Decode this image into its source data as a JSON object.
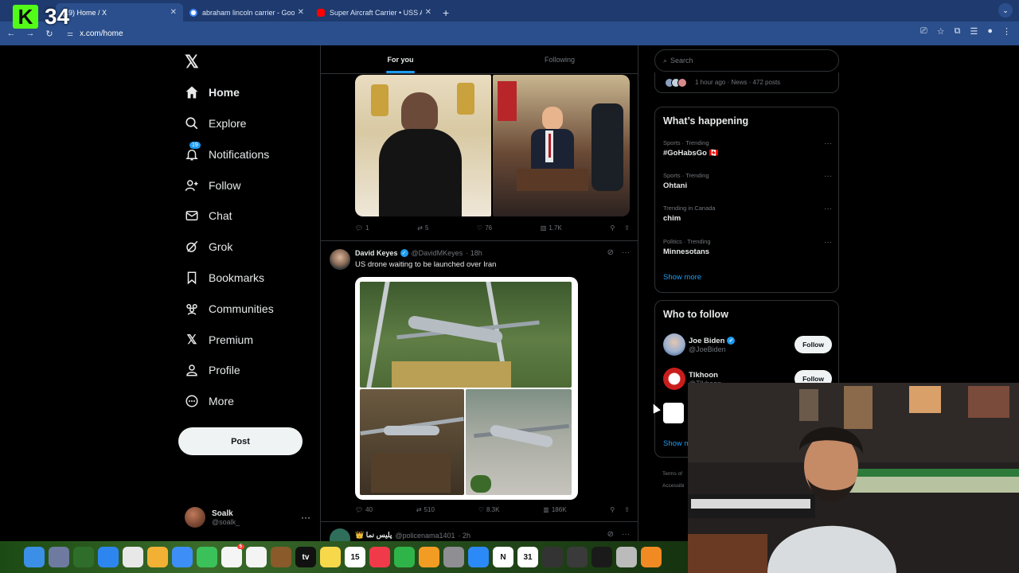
{
  "overlay": {
    "kick_letter": "K",
    "viewer_count": "34"
  },
  "browser": {
    "tabs": [
      {
        "title": "(19) Home / X",
        "active": true,
        "favicon_color": "#000000"
      },
      {
        "title": "abraham lincoln carrier - Goo",
        "active": false,
        "favicon_color": "#4285f4"
      },
      {
        "title": "Super Aircraft Carrier • USS A",
        "active": false,
        "favicon_color": "#ff0000"
      }
    ],
    "url": "x.com/home"
  },
  "nav": {
    "items": [
      {
        "label": "Home",
        "icon": "home-icon",
        "bold": true
      },
      {
        "label": "Explore",
        "icon": "search-icon"
      },
      {
        "label": "Notifications",
        "icon": "bell-icon",
        "badge": "19"
      },
      {
        "label": "Follow",
        "icon": "person-add-icon"
      },
      {
        "label": "Chat",
        "icon": "mail-icon"
      },
      {
        "label": "Grok",
        "icon": "grok-icon"
      },
      {
        "label": "Bookmarks",
        "icon": "bookmark-icon"
      },
      {
        "label": "Communities",
        "icon": "communities-icon"
      },
      {
        "label": "Premium",
        "icon": "x-premium-icon"
      },
      {
        "label": "Profile",
        "icon": "person-icon"
      },
      {
        "label": "More",
        "icon": "more-circle-icon"
      }
    ],
    "post_label": "Post",
    "account": {
      "name": "Soalk",
      "handle": "@soalk_"
    }
  },
  "timeline": {
    "tabs": [
      {
        "label": "For you",
        "active": true
      },
      {
        "label": "Following",
        "active": false
      }
    ],
    "tweet1": {
      "stats": {
        "replies": "1",
        "reposts": "5",
        "likes": "76",
        "views": "1.7K"
      }
    },
    "tweet2": {
      "name": "David Keyes",
      "handle": "@DavidMKeyes",
      "time": "· 18h",
      "text": "US drone waiting to be launched over Iran",
      "stats": {
        "replies": "40",
        "reposts": "510",
        "likes": "8.3K",
        "views": "186K"
      }
    },
    "tweet3": {
      "name": "👑 پلیس نما",
      "handle": "@policenama1401",
      "time": "· 2h"
    }
  },
  "sidebar": {
    "search_placeholder": "Search",
    "news_strip": "1 hour ago · News · 472 posts",
    "whats_happening_title": "What’s happening",
    "trends": [
      {
        "meta": "Sports · Trending",
        "name": "#GoHabsGo 🇨🇦"
      },
      {
        "meta": "Sports · Trending",
        "name": "Ohtani"
      },
      {
        "meta": "Trending in Canada",
        "name": "chim"
      },
      {
        "meta": "Politics · Trending",
        "name": "Minnesotans"
      }
    ],
    "show_more": "Show more",
    "who_to_follow_title": "Who to follow",
    "suggestions": [
      {
        "name": "Joe Biden",
        "handle": "@JoeBiden",
        "button": "Follow"
      },
      {
        "name": "Tlkhoon",
        "handle": "@Tlkhoon",
        "button": "Follow"
      }
    ],
    "show_more_2": "Show m",
    "footer": [
      "Terms of",
      "Accessibi"
    ]
  },
  "dock": {
    "apps": [
      {
        "name": "finder",
        "color": "#3b8fe6"
      },
      {
        "name": "launchpad",
        "color": "#6e7aa0"
      },
      {
        "name": "app-green",
        "color": "#2e6e2a"
      },
      {
        "name": "safari",
        "color": "#2d86f0"
      },
      {
        "name": "chrome",
        "color": "#e8e8e8"
      },
      {
        "name": "photos",
        "color": "#f2b134"
      },
      {
        "name": "mail",
        "color": "#3d8ef7"
      },
      {
        "name": "facetime",
        "color": "#3bc15a"
      },
      {
        "name": "reminders",
        "color": "#f5f5f5",
        "badge": "5"
      },
      {
        "name": "freeform",
        "color": "#f4f4f4"
      },
      {
        "name": "app-brown",
        "color": "#8a5a2b"
      },
      {
        "name": "tv",
        "color": "#111111",
        "text": "tv"
      },
      {
        "name": "notes",
        "color": "#f8d84b"
      },
      {
        "name": "calendar",
        "color": "#ffffff",
        "text": "15"
      },
      {
        "name": "news",
        "color": "#f03a4a"
      },
      {
        "name": "numbers",
        "color": "#2fb44a"
      },
      {
        "name": "pages",
        "color": "#f39c23"
      },
      {
        "name": "settings",
        "color": "#8e8e93"
      },
      {
        "name": "app-store",
        "color": "#2b8af7"
      },
      {
        "name": "notion",
        "color": "#ffffff",
        "text": "N"
      },
      {
        "name": "calendar-31",
        "color": "#ffffff",
        "text": "31"
      },
      {
        "name": "instruments",
        "color": "#333333"
      },
      {
        "name": "logic",
        "color": "#3a3a3a"
      },
      {
        "name": "app-hex",
        "color": "#1a1a1a"
      },
      {
        "name": "disk-utility",
        "color": "#bbbbbb"
      },
      {
        "name": "fl-studio",
        "color": "#f18a23"
      }
    ]
  }
}
